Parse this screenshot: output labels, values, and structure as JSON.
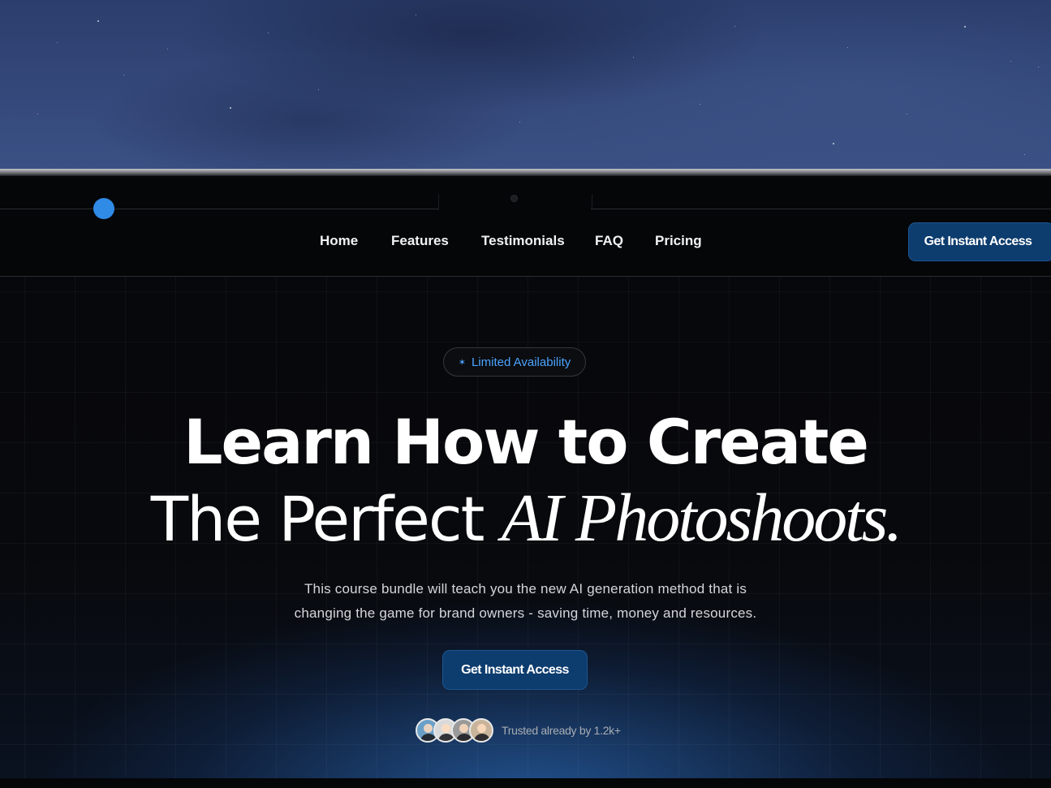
{
  "nav": {
    "items": [
      {
        "label": "Home"
      },
      {
        "label": "Features"
      },
      {
        "label": "Testimonials"
      },
      {
        "label": "FAQ"
      },
      {
        "label": "Pricing"
      }
    ],
    "cta_label": "Get Instant Access"
  },
  "hero": {
    "badge_label": "Limited Availability",
    "badge_icon": "sparkle-icon",
    "headline_line1": "Learn How to Create",
    "headline_line2_regular": "The Perfect ",
    "headline_line2_italic": "AI Photoshoots.",
    "subtext_line1": "This course bundle will teach you the new AI generation method that is",
    "subtext_line2": "changing the game for brand owners - saving time, money and resources.",
    "cta_label": "Get Instant Access",
    "trust_text": "Trusted already by 1.2k+"
  },
  "colors": {
    "accent": "#2f8be6",
    "button": "#0d3c6e",
    "badge_text": "#4aa3ff",
    "background": "#07080a"
  }
}
